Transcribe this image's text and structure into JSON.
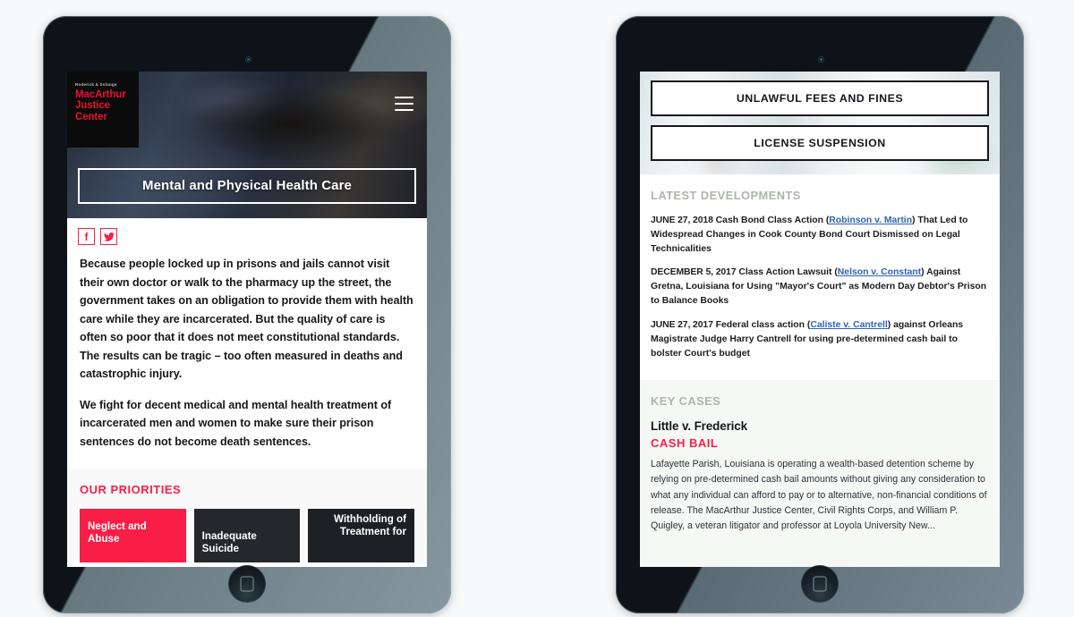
{
  "left_device": {
    "logo": {
      "kicker": "Roderick & Solange",
      "line1": "MacArthur",
      "line2": "Justice",
      "line3": "Center"
    },
    "menu_icon": "hamburger-menu-icon",
    "page_title": "Mental and Physical Health Care",
    "social": [
      {
        "name": "facebook-icon",
        "glyph": "f"
      },
      {
        "name": "twitter-icon",
        "glyph": "twitter"
      }
    ],
    "paragraphs": [
      "Because people locked up in prisons and jails cannot visit their own doctor or walk to the pharmacy up the street, the government takes on an obligation to provide them with health care while they are incarcerated. But the quality of care is often so poor that it does not meet constitutional standards. The results can be tragic – too often measured in deaths and catastrophic injury.",
      "We fight for decent medical and mental health treatment of incarcerated men and women to make sure their prison sentences do not become death sentences."
    ],
    "priorities_heading": "OUR PRIORITIES",
    "priority_cards": [
      {
        "label": "Neglect and Abuse",
        "color": "#f91e45"
      },
      {
        "label": "Inadequate Suicide",
        "color": "#24282c"
      },
      {
        "label": "Withholding of Treatment for",
        "color": "#1d2125"
      }
    ],
    "home_button": "home-button"
  },
  "right_device": {
    "top_buttons": [
      "UNLAWFUL FEES AND FINES",
      "LICENSE SUSPENSION"
    ],
    "developments_heading": "LATEST DEVELOPMENTS",
    "developments": [
      {
        "date": "JUNE 27, 2018",
        "pre": "Cash Bond Class Action (",
        "link": "Robinson v. Martin",
        "post": ") That Led to Widespread Changes in Cook County Bond Court Dismissed on Legal Technicalities"
      },
      {
        "date": "DECEMBER 5, 2017",
        "pre": "Class Action Lawsuit (",
        "link": "Nelson v. Constant",
        "post": ") Against Gretna, Louisiana for Using \"Mayor's Court\" as Modern Day Debtor's Prison to Balance Books"
      },
      {
        "date": "JUNE 27, 2017",
        "pre": "Federal class action (",
        "link": "Caliste v. Cantrell",
        "post": ") against Orleans Magistrate Judge Harry Cantrell for using pre-determined cash bail to bolster Court's budget"
      }
    ],
    "key_cases_heading": "KEY CASES",
    "key_case": {
      "title": "Little v. Frederick",
      "tag": "CASH BAIL",
      "body": "Lafayette Parish, Louisiana is operating a wealth-based detention scheme by relying on pre-determined cash bail amounts without giving any consideration to what any individual can afford to pay or to alternative, non-financial conditions of release.  The MacArthur Justice Center, Civil Rights Corps, and William P. Quigley, a veteran litigator and professor at Loyola University New..."
    },
    "home_button": "home-button"
  },
  "theme": {
    "accent_pink": "#f91e45",
    "link_blue": "#2f62b8",
    "heading_gray": "#aeb5ad",
    "dark_card": "#24282c",
    "page_bg": "#f7f9fa"
  }
}
